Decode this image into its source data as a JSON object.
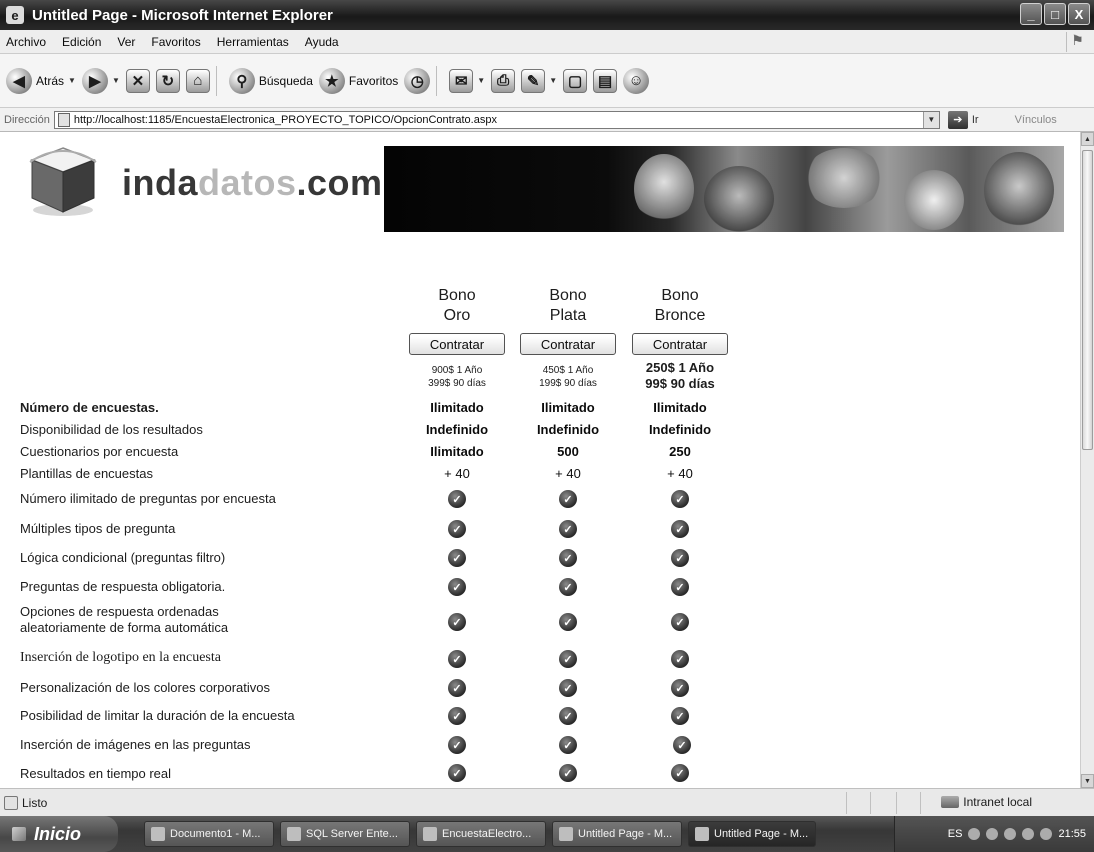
{
  "window": {
    "title": "Untitled Page - Microsoft Internet Explorer",
    "controls": [
      "_",
      "□",
      "X"
    ]
  },
  "menu": [
    "Archivo",
    "Edición",
    "Ver",
    "Favoritos",
    "Herramientas",
    "Ayuda"
  ],
  "toolbar": {
    "back_label": "Atrás",
    "search_label": "Búsqueda",
    "favorites_label": "Favoritos"
  },
  "address": {
    "label": "Dirección",
    "url": "http://localhost:1185/EncuestaElectronica_PROYECTO_TOPICO/OpcionContrato.aspx",
    "go_label": "Ir",
    "links_label": "Vínculos"
  },
  "page": {
    "logo": {
      "part1": "inda",
      "part2": "datos",
      "part3": ".com"
    },
    "plans": [
      {
        "name_line1": "Bono",
        "name_line2": "Oro",
        "button": "Contratar",
        "price_year": "900$ 1 Año",
        "price_days": "399$ 90 días",
        "price_bold": false
      },
      {
        "name_line1": "Bono",
        "name_line2": "Plata",
        "button": "Contratar",
        "price_year": "450$ 1 Año",
        "price_days": "199$ 90 días",
        "price_bold": false
      },
      {
        "name_line1": "Bono",
        "name_line2": "Bronce",
        "button": "Contratar",
        "price_year": "250$ 1 Año",
        "price_days": "99$ 90 días",
        "price_bold": true
      }
    ],
    "features": [
      {
        "label": "Número de encuestas.",
        "style": "bold",
        "values": [
          "Ilimitado",
          "Ilimitado",
          "Ilimitado"
        ],
        "value_style": "bold"
      },
      {
        "label": "Disponibilidad de los resultados",
        "values": [
          "Indefinido",
          "Indefinido",
          "Indefinido"
        ],
        "value_style": "bold"
      },
      {
        "label": "Cuestionarios por encuesta",
        "values": [
          "Ilimitado",
          "500",
          "250"
        ],
        "value_style": "bold"
      },
      {
        "label": "Plantillas de encuestas",
        "values": [
          "+ 40",
          "+ 40",
          "+ 40"
        ],
        "value_style": "normal"
      },
      {
        "label": "Número ilimitado de preguntas por encuesta",
        "check": true
      },
      {
        "label": "Múltiples tipos de pregunta",
        "check": true
      },
      {
        "label": "Lógica condicional (preguntas filtro)",
        "check": true
      },
      {
        "label": "Preguntas de respuesta obligatoria.",
        "check": true
      },
      {
        "label_line1": "Opciones de respuesta ordenadas",
        "label_line2": "aleatoriamente de forma automática",
        "check": true
      },
      {
        "label": "Inserción de logotipo en la encuesta",
        "style": "serif",
        "check": true
      },
      {
        "label": "Personalización de los colores corporativos",
        "check": true
      },
      {
        "label": "Posibilidad de limitar la duración de la encuesta",
        "check": true
      },
      {
        "label": "Inserción de imágenes en las preguntas",
        "check": true
      },
      {
        "label": "Resultados en tiempo real",
        "check": true
      }
    ],
    "check_glyph": "✓"
  },
  "status": {
    "text": "Listo",
    "zone": "Intranet local"
  },
  "taskbar": {
    "start": "Inicio",
    "tasks": [
      "Documento1 - M...",
      "SQL Server Ente...",
      "EncuestaElectro...",
      "Untitled Page - M...",
      "Untitled Page - M..."
    ],
    "lang": "ES",
    "clock": "21:55"
  }
}
